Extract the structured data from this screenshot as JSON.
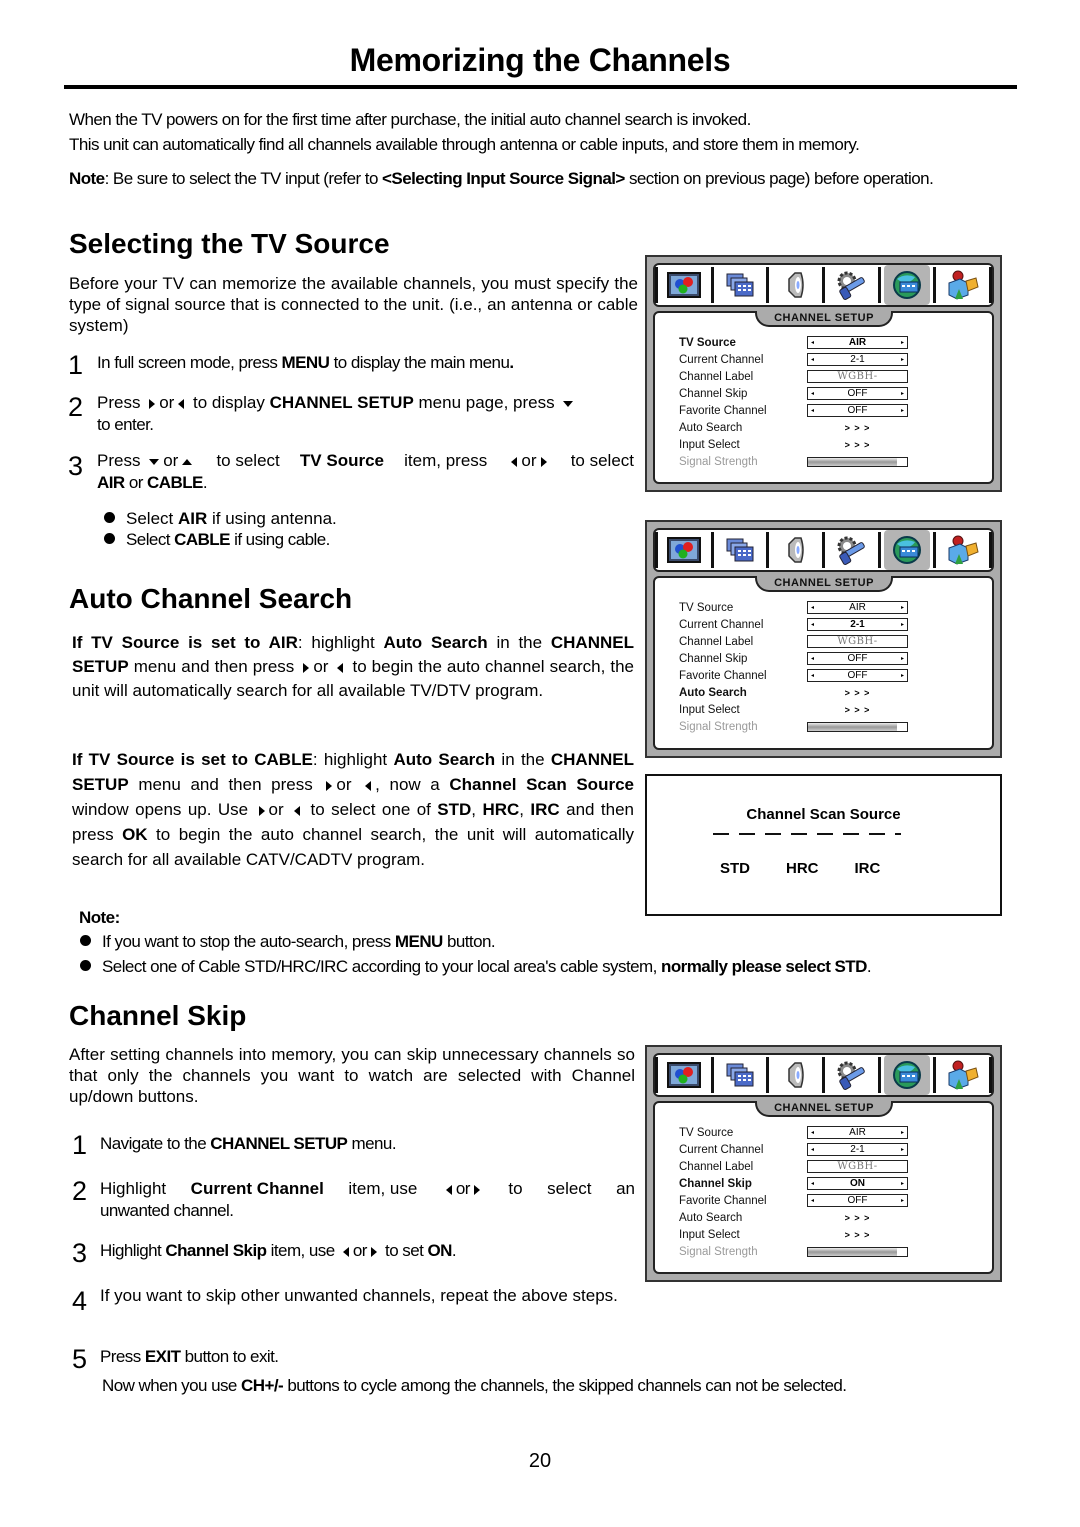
{
  "title": "Memorizing the Channels",
  "intro": {
    "line1": "When the TV powers on for the first time after purchase, the initial auto channel search is invoked.",
    "line2": "This unit can automatically find all channels available through antenna or cable inputs, and store them in memory.",
    "note_label": "Note",
    "note_pre": ":  Be sure to select the TV input (refer to ",
    "note_bold": "<Selecting Input Source Signal>",
    "note_post": " section on previous page)  before operation."
  },
  "tv_source": {
    "heading": "Selecting the TV Source",
    "paragraph": "Before your TV can memorize the available channels, you must specify the type of signal source that is connected to the unit. (i.e., an antenna or cable system)",
    "steps": [
      {
        "num": "1",
        "t1": "In full screen mode, press ",
        "b1": "MENU",
        "t2": " to display the main menu",
        "b2": "."
      },
      {
        "num": "2",
        "t1": "Press ",
        "or": "or",
        "t2": " to display ",
        "b1": "CHANNEL SETUP",
        "t3": " menu page, press ",
        "t4": "to enter."
      },
      {
        "num": "3",
        "t1": "Press ",
        "or": "or",
        "t2": " to select ",
        "b1": "TV Source",
        "t3": " item, press ",
        "t4": " to select",
        "b2": "AIR",
        "t5": " or ",
        "b3": "CABLE",
        "t6": "."
      }
    ],
    "bullets": [
      {
        "t1": "Select ",
        "b": "AIR",
        "t2": " if using antenna."
      },
      {
        "t1": "Select ",
        "b": "CABLE",
        "t2": " if using cable."
      }
    ]
  },
  "auto_search": {
    "heading": "Auto Channel Search",
    "air": {
      "b1": "If TV Source is set to AIR",
      "t1": ": highlight ",
      "b2": "Auto Search",
      "t2": " in the ",
      "b3": "CHANNEL SETUP",
      "t3": " menu and then press ",
      "or": "or",
      "t4": " to begin the auto channel search, the unit will automatically search for all available TV/DTV program."
    },
    "cable": {
      "b1": "If TV Source is set to CABLE",
      "t1": ": highlight ",
      "b2": "Auto Search",
      "t2": " in the ",
      "b3": "CHANNEL SETUP",
      "t3": " menu and then press ",
      "or": "or",
      "t4": ", now a ",
      "b4": "Channel Scan Source",
      "t5": " window opens up. Use ",
      "t6": " to select one of ",
      "b5": "STD",
      "c1": ", ",
      "b6": "HRC",
      "c2": ", ",
      "b7": "IRC",
      "t7": " and then press ",
      "b8": "OK",
      "t8": " to begin the auto channel search, the unit will automatically search for all available CATV/CADTV program."
    },
    "note_label": "Note:",
    "notes": [
      {
        "t1": "If you want to stop the auto-search, press ",
        "b": "MENU",
        "t2": " button."
      },
      {
        "t1": "Select one of Cable STD/HRC/IRC according to your local area's cable system, ",
        "b": "normally please select STD",
        "t2": "."
      }
    ]
  },
  "channel_skip": {
    "heading": "Channel Skip",
    "paragraph": "After setting channels into memory, you can skip unnecessary channels so that only the channels you want to watch are selected with Channel up/down buttons.",
    "steps": [
      {
        "num": "1",
        "t1": "Navigate to the ",
        "b1": "CHANNEL SETUP",
        "t2": " menu."
      },
      {
        "num": "2",
        "t1": "Highlight ",
        "b1": "Current Channel",
        "t2": " item, use ",
        "or": "or",
        "t3": " to select an unwanted channel."
      },
      {
        "num": "3",
        "t1": "Highlight ",
        "b1": "Channel Skip",
        "t2": " item, use ",
        "or": "or",
        "t3": " to set ",
        "b2": "ON",
        "t4": "."
      },
      {
        "num": "4",
        "t1": "If you want to skip other unwanted channels, repeat the above steps."
      },
      {
        "num": "5",
        "t1": "Press ",
        "b1": "EXIT",
        "t2": " button to exit."
      }
    ],
    "final_t1": "Now when you use ",
    "final_b": "CH+/-",
    "final_t2": " buttons to cycle among the channels, the skipped channels can not be selected."
  },
  "osd": {
    "tab_title": "CHANNEL SETUP",
    "icons": [
      "picture-icon",
      "screen-icon",
      "sound-icon",
      "setup-tools-icon",
      "channel-globe-icon",
      "lock-parental-icon"
    ],
    "active_icon_index": 4,
    "arrow_left": "◂",
    "arrow_right": "▸",
    "more": ">>>",
    "signal_strength_fraction": 0.9,
    "screens": [
      {
        "highlight": "TV Source",
        "rows": [
          {
            "label": "TV Source",
            "value": "AIR",
            "type": "select"
          },
          {
            "label": "Current Channel",
            "value": "2-1",
            "type": "select"
          },
          {
            "label": "Channel Label",
            "value": "WGBH-",
            "type": "text"
          },
          {
            "label": "Channel Skip",
            "value": "OFF",
            "type": "select"
          },
          {
            "label": "Favorite Channel",
            "value": "OFF",
            "type": "select"
          },
          {
            "label": "Auto Search",
            "value": ">>>",
            "type": "more"
          },
          {
            "label": "Input Select",
            "value": ">>>",
            "type": "more"
          },
          {
            "label": "Signal Strength",
            "value": "",
            "type": "bar"
          }
        ]
      },
      {
        "highlight": "Auto Search",
        "rows": [
          {
            "label": "TV Source",
            "value": "AIR",
            "type": "select"
          },
          {
            "label": "Current Channel",
            "value": "2-1",
            "type": "select",
            "bold": true
          },
          {
            "label": "Channel Label",
            "value": "WGBH-",
            "type": "text"
          },
          {
            "label": "Channel Skip",
            "value": "OFF",
            "type": "select"
          },
          {
            "label": "Favorite Channel",
            "value": "OFF",
            "type": "select"
          },
          {
            "label": "Auto Search",
            "value": ">>>",
            "type": "more"
          },
          {
            "label": "Input Select",
            "value": ">>>",
            "type": "more"
          },
          {
            "label": "Signal Strength",
            "value": "",
            "type": "bar"
          }
        ]
      },
      {
        "highlight": "Channel Skip",
        "rows": [
          {
            "label": "TV Source",
            "value": "AIR",
            "type": "select"
          },
          {
            "label": "Current Channel",
            "value": "2-1",
            "type": "select"
          },
          {
            "label": "Channel Label",
            "value": "WGBH-",
            "type": "text"
          },
          {
            "label": "Channel Skip",
            "value": "ON",
            "type": "select",
            "bold": true
          },
          {
            "label": "Favorite Channel",
            "value": "OFF",
            "type": "select"
          },
          {
            "label": "Auto Search",
            "value": ">>>",
            "type": "more"
          },
          {
            "label": "Input Select",
            "value": ">>>",
            "type": "more"
          },
          {
            "label": "Signal Strength",
            "value": "",
            "type": "bar"
          }
        ]
      }
    ]
  },
  "scan_source": {
    "title": "Channel Scan Source",
    "options": [
      "STD",
      "HRC",
      "IRC"
    ]
  },
  "page_number": "20"
}
